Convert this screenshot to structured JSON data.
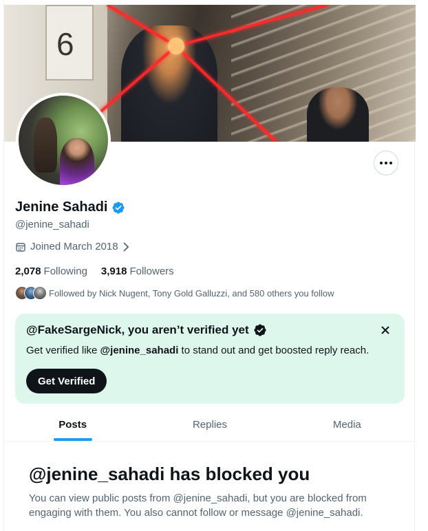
{
  "banner": {
    "sign_text": "6"
  },
  "profile": {
    "name": "Jenine Sahadi",
    "handle": "@jenine_sahadi",
    "joined": "Joined March 2018",
    "following_count": "2,078",
    "following_label": "Following",
    "followers_count": "3,918",
    "followers_label": "Followers",
    "followed_by": "Followed by Nick Nugent, Tony Gold Galluzzi, and 580 others you follow"
  },
  "verify_card": {
    "title": "@FakeSargeNick, you aren’t verified yet",
    "desc_prefix": "Get verified like ",
    "desc_handle": "@jenine_sahadi",
    "desc_suffix": " to stand out and get boosted reply reach.",
    "button": "Get Verified",
    "background": "#def7ec"
  },
  "tabs": [
    {
      "label": "Posts",
      "active": true
    },
    {
      "label": "Replies",
      "active": false
    },
    {
      "label": "Media",
      "active": false
    }
  ],
  "blocked": {
    "title": "@jenine_sahadi has blocked you",
    "desc": "You can view public posts from @jenine_sahadi, but you are blocked from engaging with them. You also cannot follow or message @jenine_sahadi."
  },
  "colors": {
    "accent": "#1d9bf0",
    "text": "#0f1419",
    "muted": "#536471"
  },
  "icons": [
    "verified-badge-icon",
    "calendar-icon",
    "chevron-right-icon",
    "more-icon",
    "close-icon"
  ]
}
